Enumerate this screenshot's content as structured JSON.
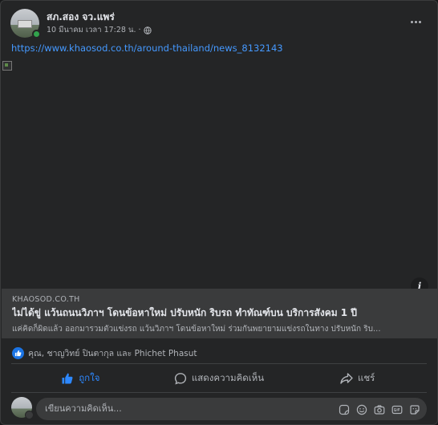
{
  "post": {
    "author": "สภ.สอง จว.แพร่",
    "timestamp": "10 มีนาคม เวลา 17:28 น. ·",
    "audience_icon": "globe-icon",
    "link_url": "https://www.khaosod.co.th/around-thailand/news_8132143"
  },
  "link_preview": {
    "domain": "KHAOSOD.CO.TH",
    "title": "ไม่ได้ขู่ แว้นถนนวิภาฯ โดนข้อหาใหม่ ปรับหนัก ริบรถ ทำทัณฑ์บน บริการสังคม 1 ปี",
    "description": "แค่คิดก็ผิดแล้ว ออกมารวมตัวแข่งรถ แว้นวิภาฯ โดนข้อหาใหม่ ร่วมกันพยายามแข่งรถในทาง ปรับหนัก ริบ...",
    "info_label": "i"
  },
  "reactions": {
    "icon": "like-icon",
    "text": "คุณ, ชาญวิทย์ ปินตากุล และ Phichet Phasut"
  },
  "actions": {
    "like": "ถูกใจ",
    "comment": "แสดงความคิดเห็น",
    "share": "แชร์"
  },
  "comment_box": {
    "placeholder": "เขียนความคิดเห็น..."
  },
  "colors": {
    "background": "#242526",
    "link": "#4599ff",
    "liked": "#2d88ff",
    "secondary_text": "#b0b3b8"
  }
}
